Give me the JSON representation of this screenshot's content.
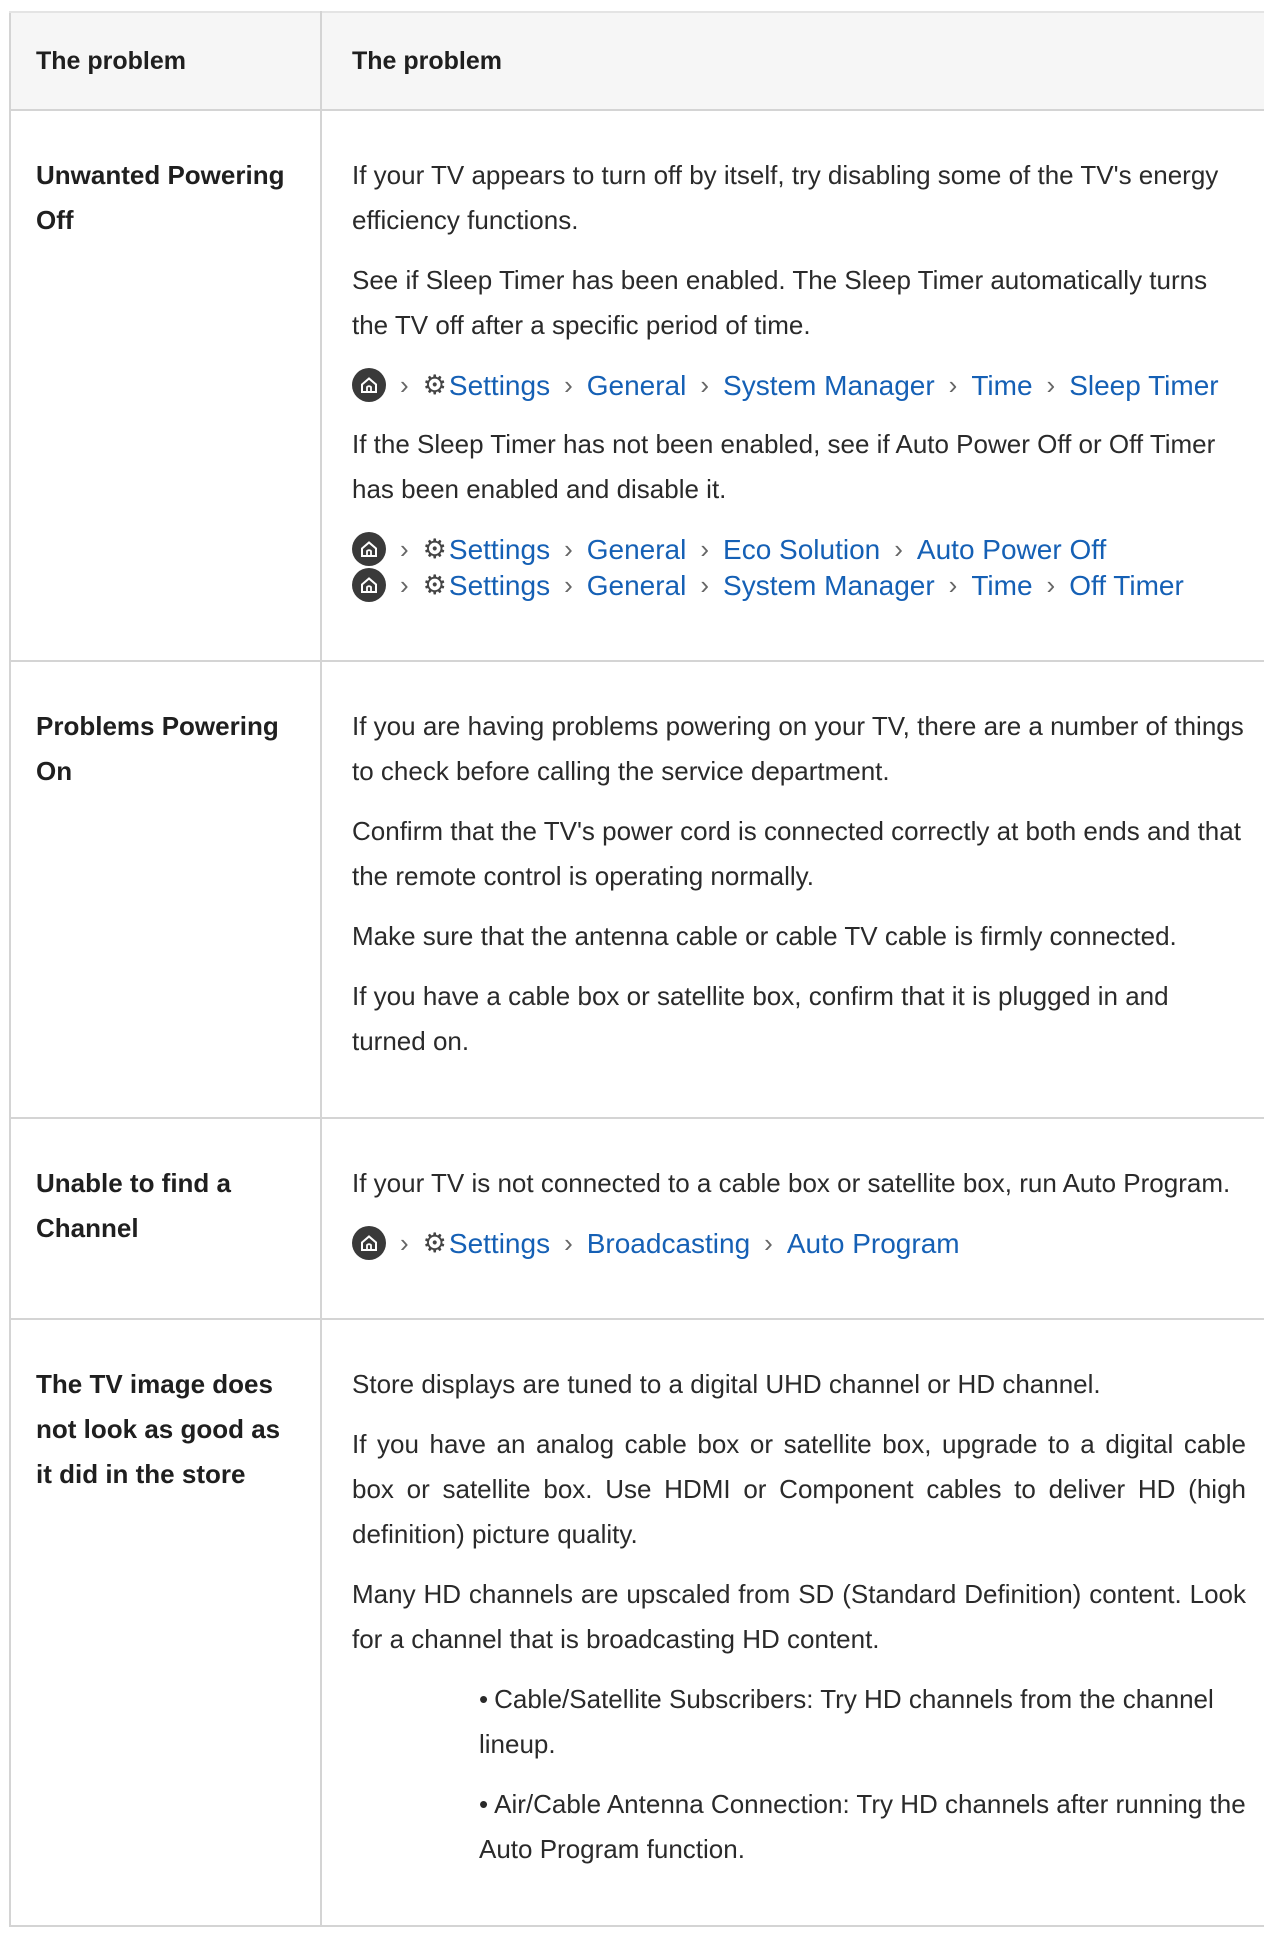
{
  "header": {
    "col1": "The problem",
    "col2": "The problem"
  },
  "rows": [
    {
      "problem": "Unwanted Powering Off",
      "p1": "If your TV appears to turn off by itself, try disabling some of the TV's energy efficiency functions.",
      "p2": "See if Sleep Timer has been enabled. The Sleep Timer automatically turns the TV off after a specific period of time.",
      "path1": [
        "Settings",
        "General",
        "System Manager",
        "Time",
        "Sleep Timer"
      ],
      "p3": "If the Sleep Timer has not been enabled, see if Auto Power Off or Off Timer has been enabled and disable it.",
      "path2": [
        "Settings",
        "General",
        "Eco Solution",
        "Auto Power Off"
      ],
      "path3": [
        "Settings",
        "General",
        "System Manager",
        "Time",
        "Off Timer"
      ]
    },
    {
      "problem": "Problems Powering On",
      "p1": "If you are having problems powering on your TV, there are a number of things to check before calling the service department.",
      "p2": "Confirm that the TV's power cord is connected correctly at both ends and that the remote control is operating normally.",
      "p3": "Make sure that the antenna cable or cable TV cable is firmly connected.",
      "p4": "If you have a cable box or satellite box, confirm that it is plugged in and turned on."
    },
    {
      "problem": "Unable to find a Channel",
      "p1": "If your TV is not connected to a cable box or satellite box, run Auto Program.",
      "path1": [
        "Settings",
        "Broadcasting",
        "Auto Program"
      ]
    },
    {
      "problem": "The TV image does not look as good as it did in the store",
      "p1": "Store displays are tuned to a digital UHD channel or HD channel.",
      "p2": "If you have an analog cable box or satellite box, upgrade to a digital cable box or satellite box. Use HDMI or Component cables to deliver HD (high definition) picture quality.",
      "p3": "Many HD channels are upscaled from SD (Standard Definition) content. Look for a channel that is broadcasting HD content.",
      "bullets": [
        "Cable/Satellite Subscribers: Try HD channels from the channel lineup.",
        "Air/Cable Antenna Connection: Try HD channels after running the Auto Program function."
      ]
    }
  ],
  "icons": {
    "home": "home-icon",
    "settings": "gear-icon",
    "separator": "chevron-right-icon"
  }
}
